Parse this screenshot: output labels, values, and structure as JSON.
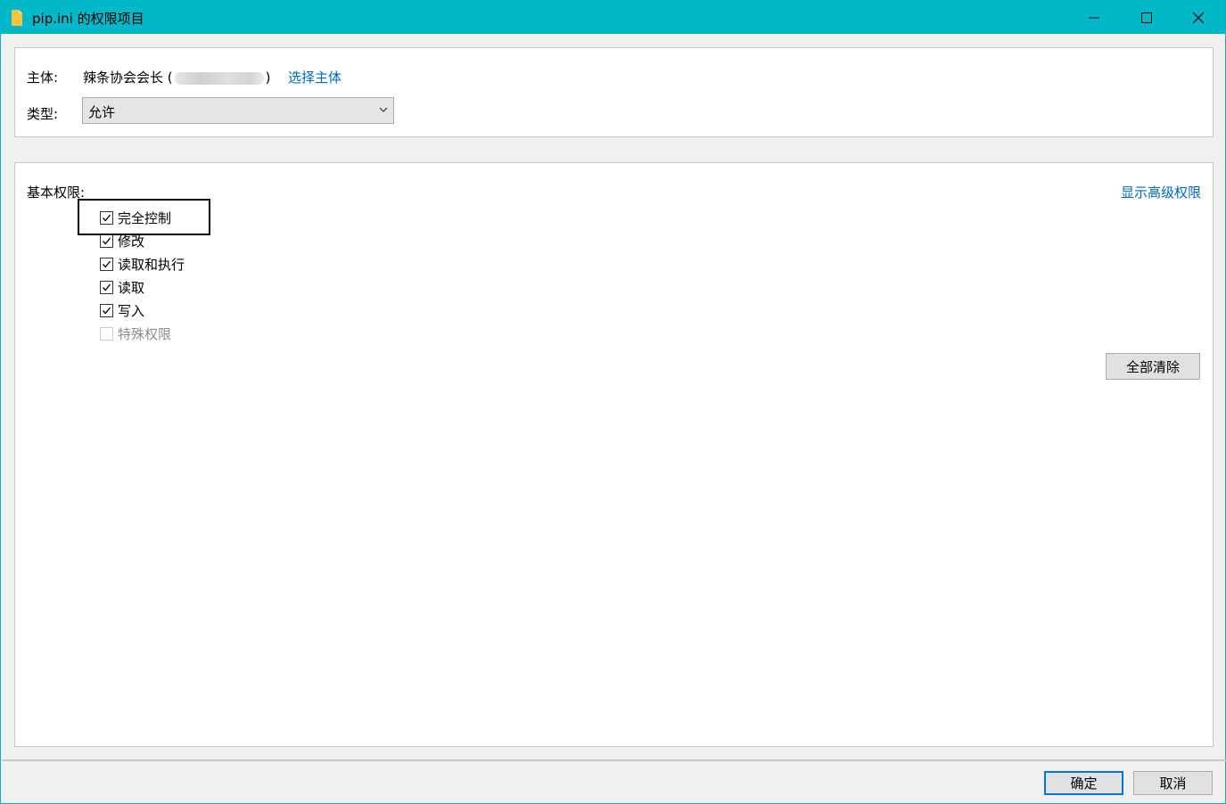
{
  "window": {
    "title": "pip.ini 的权限项目",
    "controls": {
      "minimize": "minimize",
      "maximize": "maximize",
      "close": "close"
    }
  },
  "principal": {
    "label": "主体:",
    "name_prefix": "辣条协会会长 (",
    "name_suffix": ")",
    "select_link": "选择主体"
  },
  "type": {
    "label": "类型:",
    "value": "允许"
  },
  "permissions": {
    "label": "基本权限:",
    "advanced_link": "显示高级权限",
    "items": [
      {
        "label": "完全控制",
        "checked": true,
        "enabled": true
      },
      {
        "label": "修改",
        "checked": true,
        "enabled": true
      },
      {
        "label": "读取和执行",
        "checked": true,
        "enabled": true
      },
      {
        "label": "读取",
        "checked": true,
        "enabled": true
      },
      {
        "label": "写入",
        "checked": true,
        "enabled": true
      },
      {
        "label": "特殊权限",
        "checked": false,
        "enabled": false
      }
    ],
    "clear_all_button": "全部清除"
  },
  "footer": {
    "ok_button": "确定",
    "cancel_button": "取消"
  },
  "colors": {
    "titlebar": "#00b8c8",
    "link": "#0067c0",
    "default_button_border": "#0078d7"
  }
}
